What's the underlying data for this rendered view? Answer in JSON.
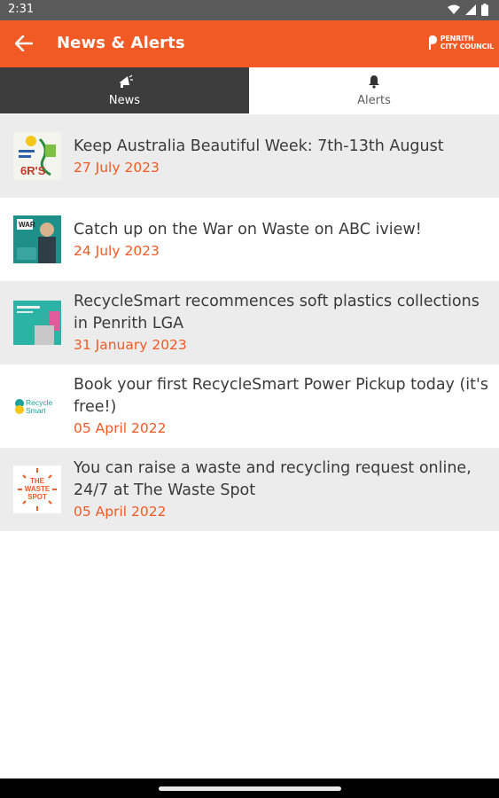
{
  "status_bar": {
    "time": "2:31"
  },
  "app_bar": {
    "title": "News & Alerts",
    "logo_lines": [
      "PENRITH",
      "CITY COUNCIL"
    ]
  },
  "tabs": [
    {
      "label": "News",
      "icon": "megaphone-icon",
      "selected": true
    },
    {
      "label": "Alerts",
      "icon": "bell-icon",
      "selected": false
    }
  ],
  "news": [
    {
      "title": "Keep Australia Beautiful Week: 7th-13th August",
      "date": "27 July 2023",
      "thumb": "kab-6rs-thumb",
      "thumb_text": "6R'S"
    },
    {
      "title": "Catch up on the War on Waste on ABC iview!",
      "date": "24 July 2023",
      "thumb": "war-on-waste-thumb",
      "thumb_text": "WAR"
    },
    {
      "title": "RecycleSmart recommences soft plastics collections in Penrith LGA",
      "date": "31 January 2023",
      "thumb": "soft-plastics-thumb",
      "thumb_text": ""
    },
    {
      "title": "Book your first RecycleSmart Power Pickup today (it's free!)",
      "date": "05 April 2022",
      "thumb": "recyclesmart-logo-thumb",
      "thumb_text": "Recycle Smart"
    },
    {
      "title": "You can raise a waste and recycling request online, 24/7 at The Waste Spot",
      "date": "05 April 2022",
      "thumb": "waste-spot-thumb",
      "thumb_text": "THE WASTE SPOT"
    }
  ],
  "colors": {
    "accent": "#f15a24",
    "tab_selected": "#3c3c3c",
    "row_shade": "#ececec"
  }
}
